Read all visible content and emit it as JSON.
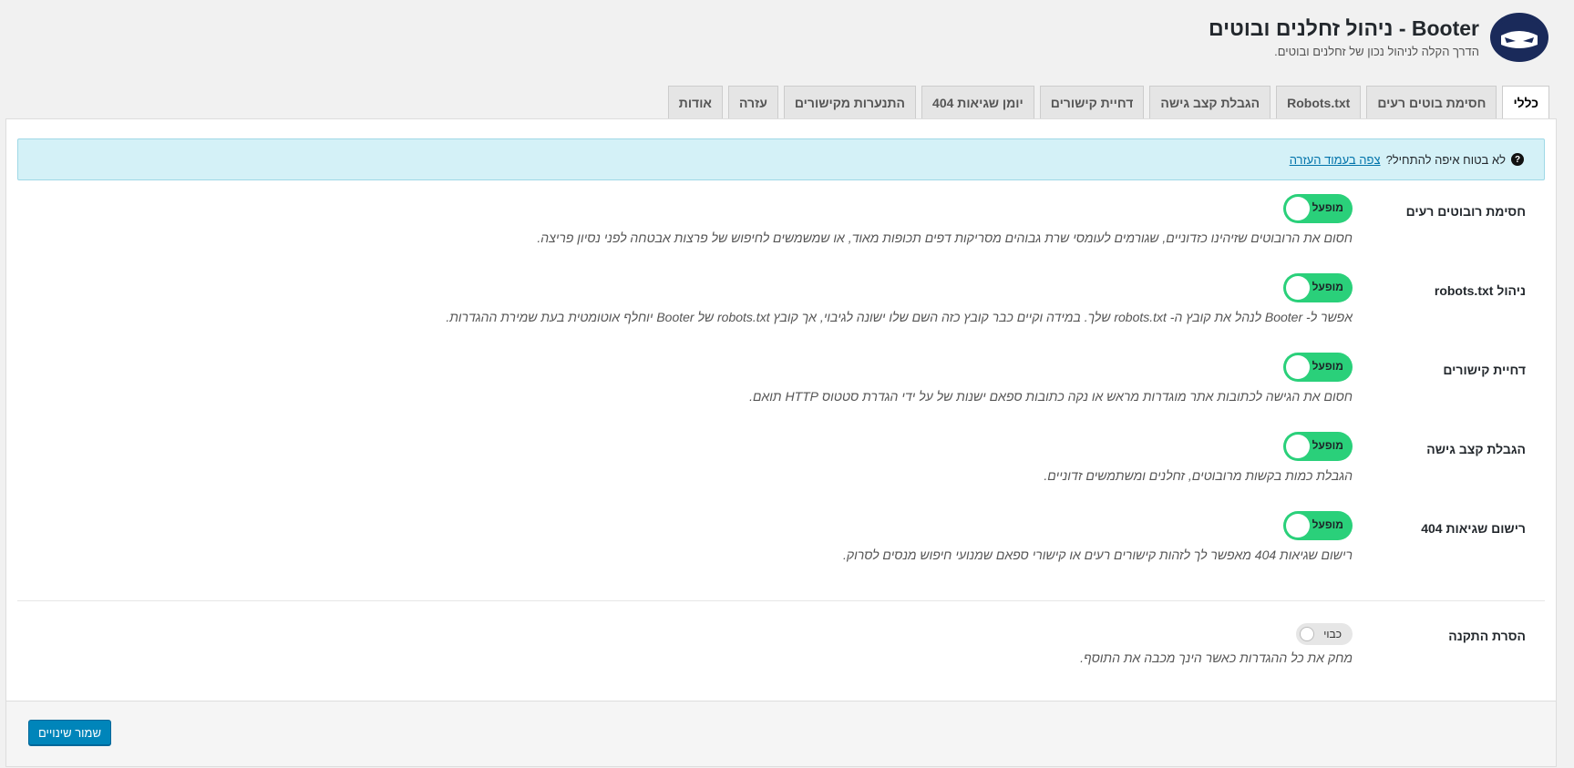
{
  "header": {
    "title": "Booter - ניהול זחלנים ובוטים",
    "subtitle": "הדרך הקלה לניהול נכון של זחלנים ובוטים."
  },
  "tabs": [
    {
      "label": "כללי",
      "active": true
    },
    {
      "label": "חסימת בוטים רעים",
      "active": false
    },
    {
      "label": "Robots.txt",
      "active": false
    },
    {
      "label": "הגבלת קצב גישה",
      "active": false
    },
    {
      "label": "דחיית קישורים",
      "active": false
    },
    {
      "label": "יומן שגיאות 404",
      "active": false
    },
    {
      "label": "התנערות מקישורים",
      "active": false
    },
    {
      "label": "עזרה",
      "active": false
    },
    {
      "label": "אודות",
      "active": false
    }
  ],
  "notice": {
    "text": "לא בטוח איפה להתחיל?",
    "link": "צפה בעמוד העזרה"
  },
  "settings": [
    {
      "label": "חסימת רובוטים רעים",
      "toggle": "מופעל",
      "enabled": true,
      "description": "חסום את הרובוטים שזיהינו כזדוניים, שגורמים לעומסי שרת גבוהים מסריקות דפים תכופות מאוד, או שמשמשים לחיפוש של פרצות אבטחה לפני נסיון פריצה."
    },
    {
      "label": "ניהול robots.txt",
      "toggle": "מופעל",
      "enabled": true,
      "description": "אפשר ל- Booter לנהל את קובץ ה- robots.txt שלך. במידה וקיים כבר קובץ כזה השם שלו ישונה לגיבוי, אך קובץ robots.txt של Booter יוחלף אוטומטית בעת שמירת ההגדרות."
    },
    {
      "label": "דחיית קישורים",
      "toggle": "מופעל",
      "enabled": true,
      "description": "חסום את הגישה לכתובות אתר מוגדרות מראש או נקה כתובות ספאם ישנות של על ידי הגדרת סטטוס HTTP תואם."
    },
    {
      "label": "הגבלת קצב גישה",
      "toggle": "מופעל",
      "enabled": true,
      "description": "הגבלת כמות בקשות מרובוטים, זחלנים ומשתמשים זדוניים."
    },
    {
      "label": "רישום שגיאות 404",
      "toggle": "מופעל",
      "enabled": true,
      "description": "רישום שגיאות 404 מאפשר לך לזהות קישורים רעים או קישורי ספאם שמנועי חיפוש מנסים לסרוק."
    },
    {
      "label": "הסרת התקנה",
      "toggle": "כבוי",
      "enabled": false,
      "description": "מחק את כל ההגדרות כאשר הינך מכבה את התוסף."
    }
  ],
  "footer": {
    "save_label": "שמור שינויים"
  },
  "colors": {
    "toggle_on": "#2ad07a",
    "toggle_off": "#e6e6e6",
    "notice_bg": "#d4f1f7",
    "primary_button": "#0085ba",
    "logo": "#1a2a5a"
  },
  "icons": {
    "logo": "masked-ninja-face-icon",
    "notice": "question-circle-icon"
  }
}
